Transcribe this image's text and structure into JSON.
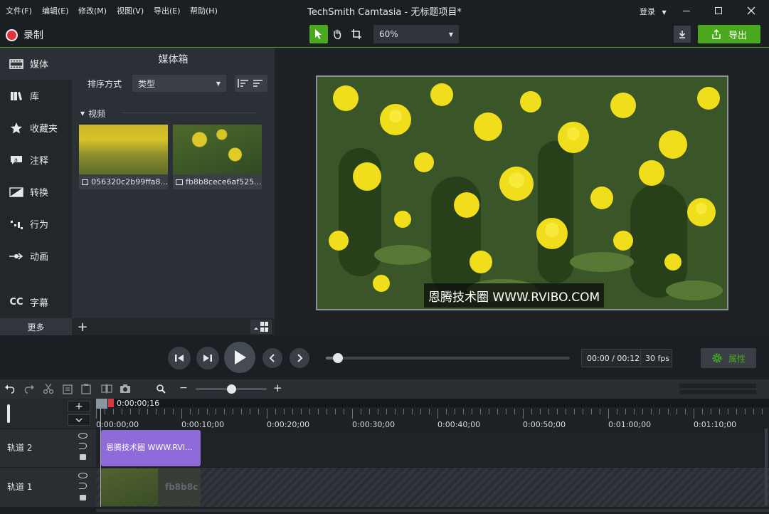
{
  "app": {
    "title": "TechSmith Camtasia - 无标题项目*"
  },
  "menu": [
    {
      "label": "文件(F)"
    },
    {
      "label": "编辑(E)"
    },
    {
      "label": "修改(M)"
    },
    {
      "label": "视图(V)"
    },
    {
      "label": "导出(E)"
    },
    {
      "label": "帮助(H)"
    }
  ],
  "account": {
    "login_label": "登录"
  },
  "toolbar": {
    "record_label": "录制",
    "zoom_value": "60%",
    "export_label": "导出"
  },
  "nav": [
    {
      "label": "媒体",
      "icon": "film-icon"
    },
    {
      "label": "库",
      "icon": "library-icon"
    },
    {
      "label": "收藏夹",
      "icon": "star-icon"
    },
    {
      "label": "注释",
      "icon": "annotation-icon"
    },
    {
      "label": "转换",
      "icon": "transition-icon"
    },
    {
      "label": "行为",
      "icon": "behavior-icon"
    },
    {
      "label": "动画",
      "icon": "animation-icon"
    },
    {
      "label": "字幕",
      "icon": "cc-icon"
    }
  ],
  "nav_more_label": "更多",
  "bin": {
    "title": "媒体箱",
    "sort_label": "排序方式",
    "sort_value": "类型",
    "section": "视频",
    "items": [
      {
        "name": "056320c2b99ffa8..."
      },
      {
        "name": "fb8b8cece6af525..."
      }
    ]
  },
  "preview": {
    "watermark": "恩腾技术圈 WWW.RVIBO.COM"
  },
  "player": {
    "time": "00:00 / 00:12",
    "fps": "30 fps",
    "progress": 0.05,
    "properties_label": "属性"
  },
  "timeline": {
    "zoom_level": 0.5,
    "playhead_time": "0:00:00;16",
    "ruler": [
      "0:00:00;00",
      "0:00:10;00",
      "0:00:20;00",
      "0:00:30;00",
      "0:00:40;00",
      "0:00:50;00",
      "0:01:00;00",
      "0:01:10;00"
    ],
    "tracks": [
      {
        "name": "轨道 2",
        "clip": "恩腾技术圈 WWW.RVI..."
      },
      {
        "name": "轨道 1",
        "clip": "fb8b8c"
      }
    ]
  },
  "colors": {
    "accent": "#49a81e",
    "record": "#e0333c",
    "clip_text": "#8e6bd8"
  }
}
